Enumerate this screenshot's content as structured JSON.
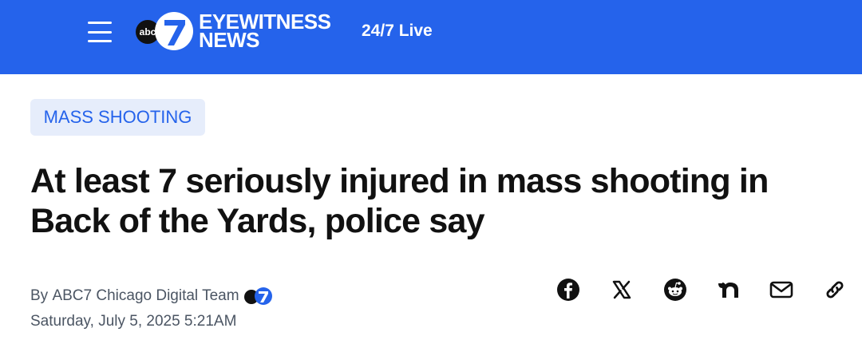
{
  "header": {
    "logo_abc": "abc",
    "logo_line1": "EYEWITNESS",
    "logo_line2": "NEWS",
    "live_label": "24/7 Live",
    "brand_color": "#2563eb"
  },
  "article": {
    "category": "MASS SHOOTING",
    "headline": "At least 7 seriously injured in mass shooting in Back of the Yards, police say",
    "byline_prefix": "By ",
    "author": "ABC7 Chicago Digital Team",
    "date": "Saturday, July 5, 2025 5:21AM"
  },
  "share_icons": [
    "facebook-icon",
    "x-icon",
    "reddit-icon",
    "nextdoor-icon",
    "email-icon",
    "link-icon"
  ]
}
